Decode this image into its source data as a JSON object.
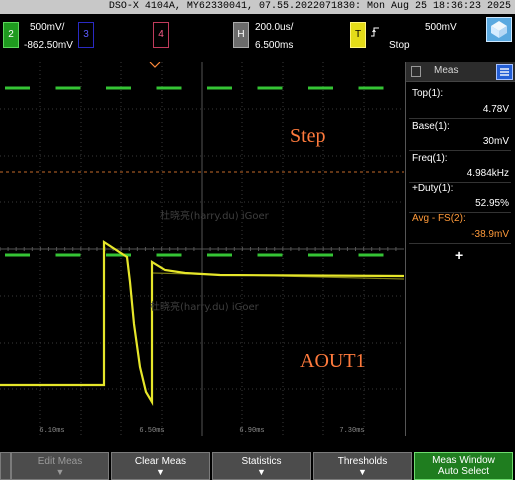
{
  "title_bar": {
    "text": "DSO-X 4104A, MY62330041, 07.55.2022071830: Mon Aug 25 18:36:23 2025"
  },
  "channels": {
    "ch1": {
      "number": "2",
      "scale": "500mV/",
      "offset": "-862.50mV"
    },
    "ch3": {
      "number": "3"
    },
    "ch4": {
      "number": "4"
    },
    "horizontal": {
      "label": "H",
      "timebase": "200.0us/",
      "delay": "6.500ms"
    },
    "trigger": {
      "label": "T",
      "level": "500mV",
      "status": "Stop",
      "icon": "rising-edge-icon"
    }
  },
  "screen": {
    "annotations": [
      {
        "text": "Step"
      },
      {
        "text": "AOUT1"
      }
    ],
    "x_ticks": [
      "6.10ms",
      "6.50ms",
      "6.90ms",
      "7.30ms"
    ],
    "watermark": "杜晓亮(harry.du) iGoer"
  },
  "meas_panel": {
    "title": "Meas",
    "items": [
      {
        "label": "Top(1):",
        "value": "4.78V",
        "color": "white"
      },
      {
        "label": "Base(1):",
        "value": "30mV",
        "color": "white"
      },
      {
        "label": "Freq(1):",
        "value": "4.984kHz",
        "color": "white"
      },
      {
        "label": "+Duty(1):",
        "value": "52.95%",
        "color": "white"
      },
      {
        "label": "Avg - FS(2):",
        "value": "-38.9mV",
        "color": "orange"
      }
    ],
    "add_label": "+"
  },
  "softkeys": [
    {
      "label": "",
      "disabled": true
    },
    {
      "label": "Edit Meas",
      "disabled": true
    },
    {
      "label": "Clear Meas",
      "disabled": false
    },
    {
      "label": "Statistics",
      "disabled": false
    },
    {
      "label": "Thresholds",
      "disabled": false
    },
    {
      "label": "Meas Window",
      "label2": "Auto Select",
      "disabled": false
    }
  ],
  "colors": {
    "ch1_green": "#35c435",
    "aout_yellow": "#e6e62a",
    "grid": "#3a3a3a",
    "annotation_orange": "#ff7a3c",
    "trigger_marker": "#ff8a3a"
  }
}
